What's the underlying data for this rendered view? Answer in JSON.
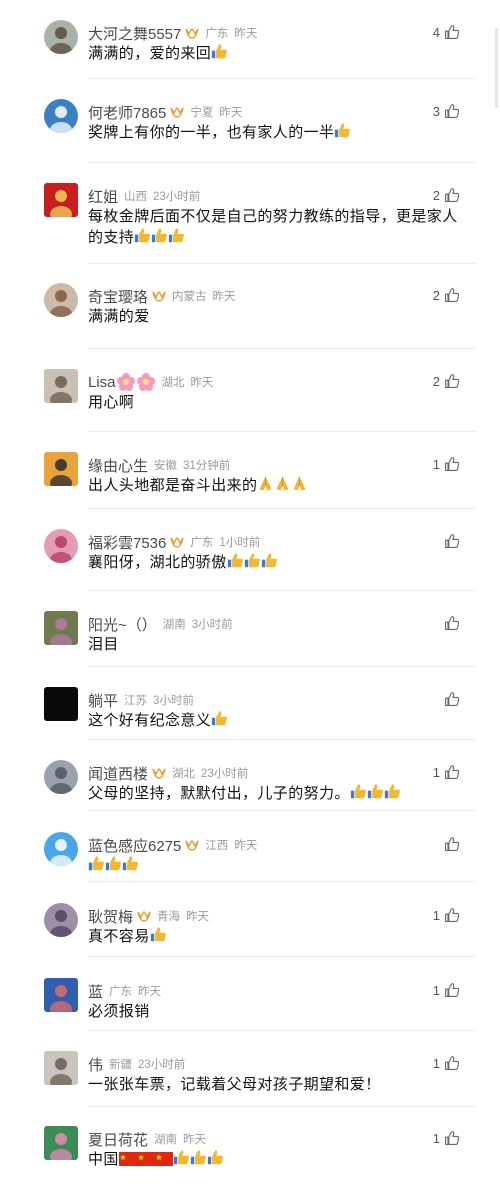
{
  "comments": [
    {
      "name": "大河之舞5557",
      "vip": true,
      "region": "广东",
      "time": "昨天",
      "text": "满满的，爱的来回",
      "thumbs": 1,
      "likes": "4",
      "avatar": {
        "bg": "#a9b3a8",
        "fg": "#5c4a3c"
      }
    },
    {
      "name": "何老师7865",
      "vip": true,
      "region": "宁夏",
      "time": "昨天",
      "text": "奖牌上有你的一半，也有家人的一半",
      "thumbs": 1,
      "likes": "3",
      "avatar": {
        "bg": "#3d7fc4",
        "fg": "#ffffff"
      }
    },
    {
      "name": "红姐",
      "vip": false,
      "region": "山西",
      "time": "23小时前",
      "text": "每枚金牌后面不仅是自己的努力教练的指导，更是家人的支持",
      "thumbs": 3,
      "likes": "2",
      "avatar": {
        "bg": "#c81e1e",
        "fg": "#f4d35e"
      },
      "square": true
    },
    {
      "name": "奇宝璎珞",
      "vip": true,
      "region": "内蒙古",
      "time": "昨天",
      "text": "满满的爱",
      "thumbs": 0,
      "likes": "2",
      "avatar": {
        "bg": "#cdb9a6",
        "fg": "#7b5a44"
      }
    },
    {
      "name": "Lisa",
      "vip": false,
      "flowers": 2,
      "region": "湖北",
      "time": "昨天",
      "text": "用心啊",
      "thumbs": 0,
      "likes": "2",
      "avatar": {
        "bg": "#c9c0b5",
        "fg": "#6e5b4b"
      },
      "square": true
    },
    {
      "name": "缘由心生",
      "vip": false,
      "region": "安徽",
      "time": "31分钟前",
      "text": "出人头地都是奋斗出来的",
      "pray": 3,
      "thumbs": 0,
      "likes": "1",
      "avatar": {
        "bg": "#e8a33c",
        "fg": "#2a2a2a"
      },
      "square": true
    },
    {
      "name": "福彩雲7536",
      "vip": true,
      "region": "广东",
      "time": "1小时前",
      "text": "襄阳伢，湖北的骄傲",
      "thumbs": 3,
      "likes": "",
      "avatar": {
        "bg": "#e59bb4",
        "fg": "#b23a63"
      }
    },
    {
      "name": "阳光~（）",
      "vip": false,
      "region": "湖南",
      "time": "3小时前",
      "text": "泪目",
      "thumbs": 0,
      "likes": "",
      "avatar": {
        "bg": "#6f7a4e",
        "fg": "#b77aa6"
      },
      "square": true
    },
    {
      "name": "躺平",
      "vip": false,
      "region": "江苏",
      "time": "3小时前",
      "text": "这个好有纪念意义",
      "thumbs": 1,
      "likes": "",
      "avatar": {
        "bg": "#0a0a0a",
        "fg": "#0a0a0a"
      },
      "square": true
    },
    {
      "name": "闻道西楼",
      "vip": true,
      "region": "湖北",
      "time": "23小时前",
      "text": "父母的坚持，默默付出，儿子的努力。",
      "thumbs": 3,
      "likes": "1",
      "avatar": {
        "bg": "#9aa3ad",
        "fg": "#4e5660"
      }
    },
    {
      "name": "蓝色感应6275",
      "vip": true,
      "region": "江西",
      "time": "昨天",
      "text": "",
      "thumbs": 3,
      "likes": "",
      "avatar": {
        "bg": "#4aa6e8",
        "fg": "#ffffff"
      }
    },
    {
      "name": "耿贺梅",
      "vip": true,
      "region": "青海",
      "time": "昨天",
      "text": "真不容易",
      "thumbs": 1,
      "likes": "1",
      "avatar": {
        "bg": "#9c8fa6",
        "fg": "#52405e"
      }
    },
    {
      "name": "蓝",
      "vip": false,
      "region": "广东",
      "time": "昨天",
      "text": "必须报销",
      "thumbs": 0,
      "likes": "1",
      "avatar": {
        "bg": "#2f5fae",
        "fg": "#e06c6c"
      },
      "square": true
    },
    {
      "name": "伟",
      "vip": false,
      "region": "新疆",
      "time": "23小时前",
      "text": "一张张车票，记载着父母对孩子期望和爱！",
      "thumbs": 0,
      "likes": "1",
      "avatar": {
        "bg": "#c9c4bc",
        "fg": "#6a5d50"
      },
      "square": true
    },
    {
      "name": "夏日荷花",
      "vip": false,
      "region": "湖南",
      "time": "昨天",
      "text": "中国",
      "flags": 3,
      "thumbs": 3,
      "likes": "1",
      "avatar": {
        "bg": "#3d8b55",
        "fg": "#e889b5"
      },
      "square": true
    }
  ],
  "colors": {
    "vip": "#e9a23b",
    "thumb": "#f2b830",
    "like_icon": "#666666"
  }
}
